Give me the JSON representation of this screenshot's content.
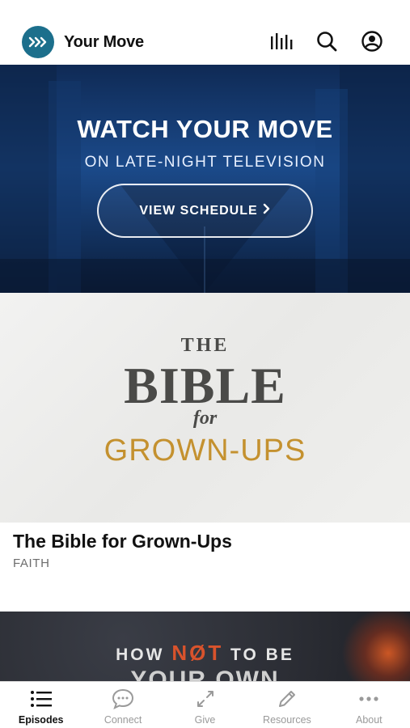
{
  "header": {
    "app_name": "Your Move",
    "icons": [
      "bars-icon",
      "search-icon",
      "account-icon"
    ]
  },
  "banner": {
    "title": "WATCH YOUR MOVE",
    "subtitle": "ON LATE-NIGHT TELEVISION",
    "button_label": "VIEW SCHEDULE"
  },
  "featured": {
    "art_the": "THE",
    "art_bible": "BIBLE",
    "art_for": "for",
    "art_grown": "GROWN-UPS",
    "title": "The Bible for Grown-Ups",
    "category": "FAITH"
  },
  "next_card": {
    "line_how": "HOW",
    "line_not": "NØT",
    "line_tobe": "TO BE",
    "line_partial": "YOUR OWN"
  },
  "tabs": [
    {
      "label": "Episodes",
      "icon": "list-icon",
      "active": true
    },
    {
      "label": "Connect",
      "icon": "chat-bubble-icon",
      "active": false
    },
    {
      "label": "Give",
      "icon": "arrows-icon",
      "active": false
    },
    {
      "label": "Resources",
      "icon": "pencil-icon",
      "active": false
    },
    {
      "label": "About",
      "icon": "more-icon",
      "active": false
    }
  ],
  "colors": {
    "brand": "#1c6f8c",
    "accent_gold": "#c4912f",
    "banner_blue": "#1b4a8a"
  }
}
